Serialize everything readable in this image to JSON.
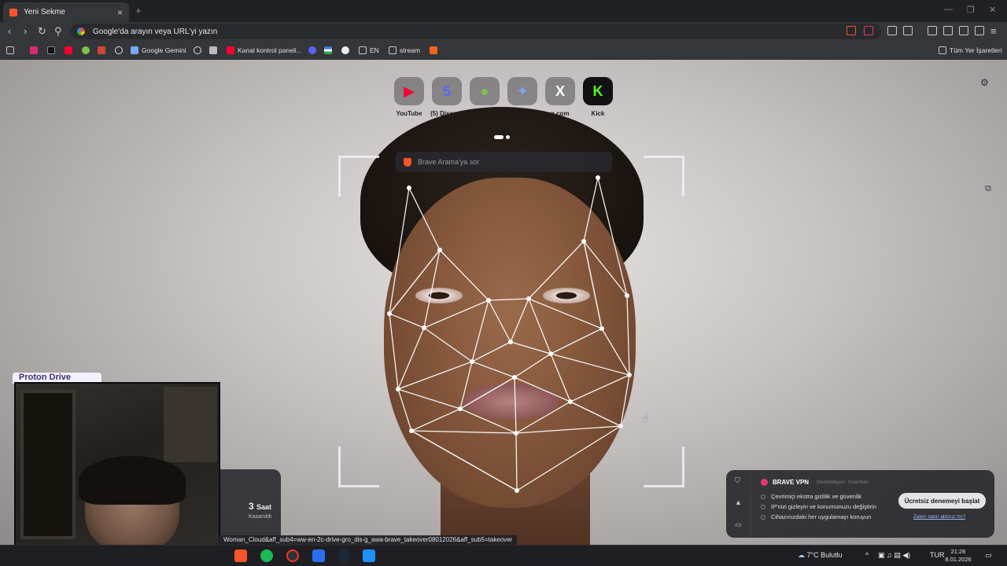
{
  "browser": {
    "tab_title": "Yeni Sekme",
    "tab_close": "×",
    "new_tab": "+",
    "omnibox_text": "Google'da arayın veya URL'yi yazın"
  },
  "bookmarks": {
    "google_gemini": "Google Gemini",
    "kanal": "Kanal kontrol paneli...",
    "en": "EN",
    "stream": "stream",
    "all_bookmarks": "Tüm Yer İşaretleri"
  },
  "speed_dial": [
    {
      "label": "YouTube",
      "glyph": "▶",
      "color": "#ff0033"
    },
    {
      "label": "(5) Discord",
      "glyph": "5",
      "color": "#5865f2"
    },
    {
      "label": "ekşi sözlük",
      "glyph": "●",
      "color": "#81c14b"
    },
    {
      "label": "Google Ge...",
      "glyph": "✦",
      "color": "#7aa8f5"
    },
    {
      "label": "x.com",
      "glyph": "X",
      "color": "#ffffff"
    },
    {
      "label": "Kick",
      "glyph": "K",
      "color": "#53fc18"
    }
  ],
  "search": {
    "placeholder": "Brave Arama'ya sor"
  },
  "widgets": {
    "proton_text": "Proton Drive",
    "rewards_value": "3",
    "rewards_unit": "Saat",
    "rewards_label": "Kazanıldı"
  },
  "vpn": {
    "title": "BRAVE VPN",
    "by": "Destekleyen: Guardian",
    "features": [
      "Çevrimiçi ekstra gizlilik ve güvenlik",
      "IP'nizi gizleyin ve konumunuzu değiştirin",
      "Cihazınızdaki her uygulamayı koruyun"
    ],
    "cta": "Ücretsiz denemeyi başlat",
    "link": "Zaten satın aldınız mı?"
  },
  "status_url": "Woman_Cloud&aff_sub4=ww-en-2c-drive-gro_dis-g_awa-brave_takeover08012026&aff_sub5=takeover",
  "taskbar": {
    "weather": "7°C  Bulutlu",
    "lang": "TUR",
    "time": "21:26",
    "date": "8.01.2026"
  }
}
